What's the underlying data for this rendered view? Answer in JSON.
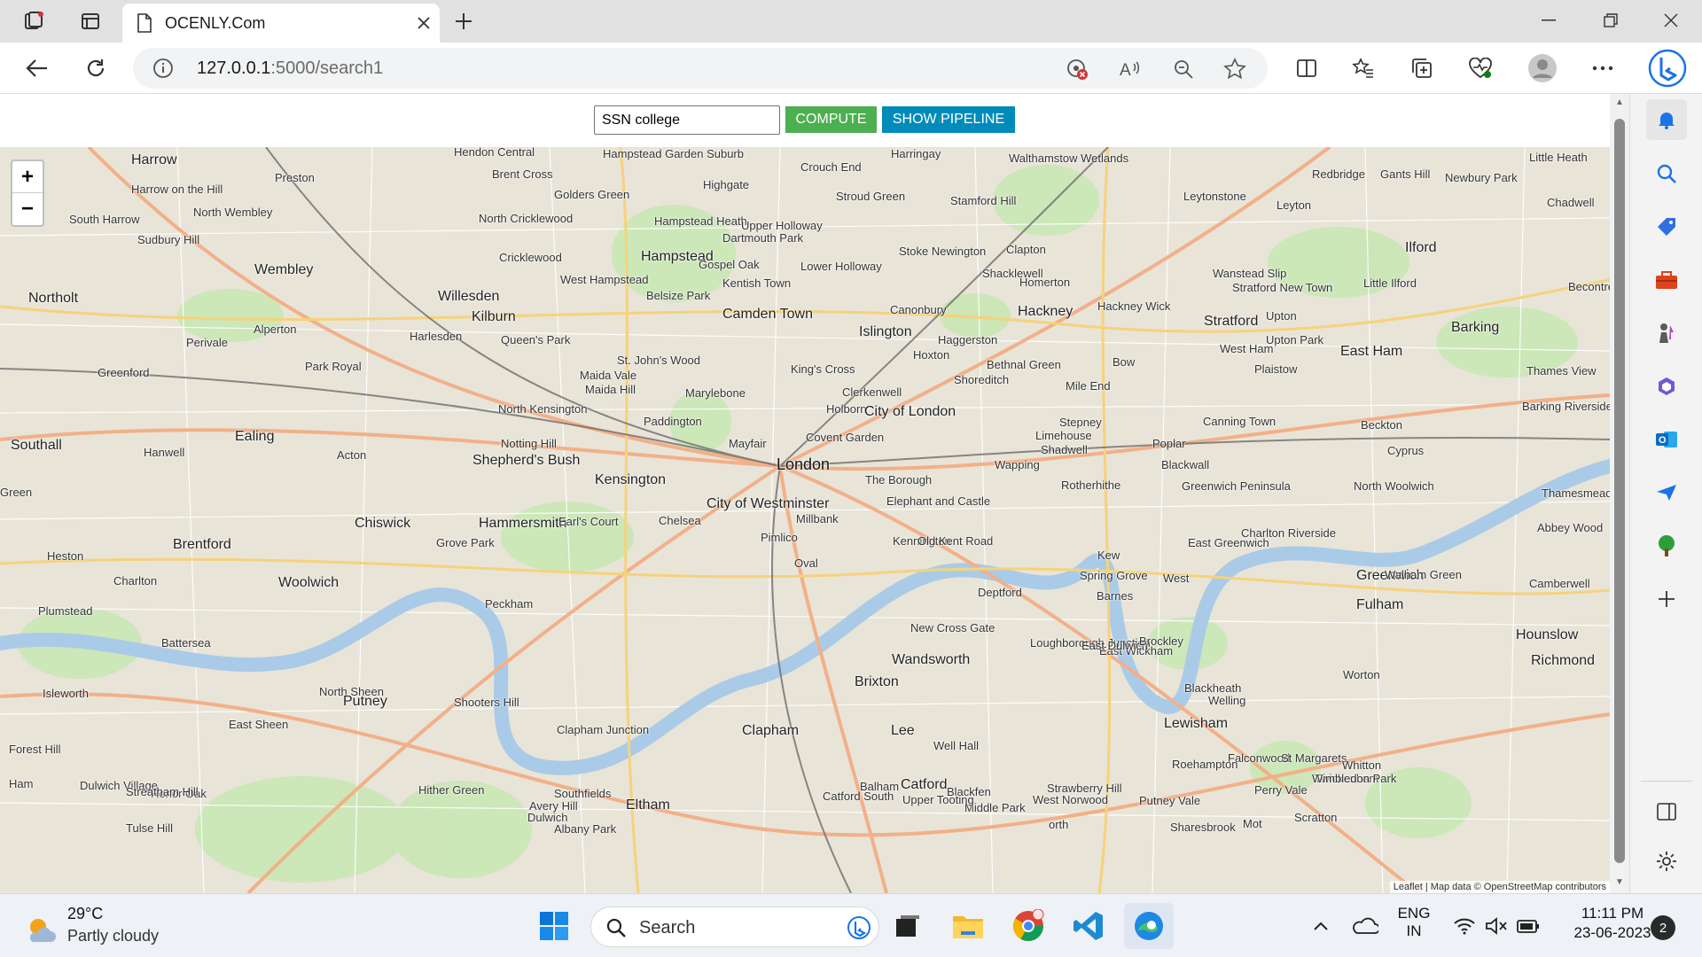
{
  "browser": {
    "tab_title": "OCENLY.Com",
    "url_host": "127.0.0.1",
    "url_rest": ":5000/search1"
  },
  "page": {
    "search_value": "SSN college",
    "compute_label": "COMPUTE",
    "pipeline_label": "SHOW PIPELINE",
    "zoom_in": "+",
    "zoom_out": "−",
    "attribution": "Leaflet | Map data © OpenStreetMap contributors"
  },
  "map_labels": [
    {
      "t": "Harrow",
      "c": "big"
    },
    {
      "t": "Hendon Central",
      "c": ""
    },
    {
      "t": "Hampstead Garden Suburb",
      "c": ""
    },
    {
      "t": "Crouch End",
      "c": ""
    },
    {
      "t": "Harringay",
      "c": ""
    },
    {
      "t": "Walthamstow Wetlands",
      "c": ""
    },
    {
      "t": "Leyton",
      "c": ""
    },
    {
      "t": "Redbridge",
      "c": ""
    },
    {
      "t": "Gants Hill",
      "c": ""
    },
    {
      "t": "Newbury Park",
      "c": ""
    },
    {
      "t": "Little Heath",
      "c": ""
    },
    {
      "t": "Preston",
      "c": ""
    },
    {
      "t": "Brent Cross",
      "c": ""
    },
    {
      "t": "Highgate",
      "c": ""
    },
    {
      "t": "Stroud Green",
      "c": ""
    },
    {
      "t": "Stamford Hill",
      "c": ""
    },
    {
      "t": "Leytonstone",
      "c": ""
    },
    {
      "t": "Chadwell",
      "c": ""
    },
    {
      "t": "Harrow on the Hill",
      "c": ""
    },
    {
      "t": "Golders Green",
      "c": ""
    },
    {
      "t": "North Wembley",
      "c": ""
    },
    {
      "t": "North Cricklewood",
      "c": ""
    },
    {
      "t": "Hampstead Heath",
      "c": ""
    },
    {
      "t": "Upper Holloway",
      "c": ""
    },
    {
      "t": "South Harrow",
      "c": ""
    },
    {
      "t": "Sudbury Hill",
      "c": ""
    },
    {
      "t": "Dartmouth Park",
      "c": ""
    },
    {
      "t": "Stoke Newington",
      "c": ""
    },
    {
      "t": "Clapton",
      "c": ""
    },
    {
      "t": "Ilford",
      "c": "big"
    },
    {
      "t": "Cricklewood",
      "c": ""
    },
    {
      "t": "Hampstead",
      "c": "big"
    },
    {
      "t": "Gospel Oak",
      "c": ""
    },
    {
      "t": "Lower Holloway",
      "c": ""
    },
    {
      "t": "Shacklewell",
      "c": ""
    },
    {
      "t": "Wanstead Slip",
      "c": ""
    },
    {
      "t": "Wembley",
      "c": "big"
    },
    {
      "t": "West Hampstead",
      "c": ""
    },
    {
      "t": "Kentish Town",
      "c": ""
    },
    {
      "t": "Homerton",
      "c": ""
    },
    {
      "t": "Stratford New Town",
      "c": ""
    },
    {
      "t": "Little Ilford",
      "c": ""
    },
    {
      "t": "Northolt",
      "c": "big"
    },
    {
      "t": "Willesden",
      "c": "big"
    },
    {
      "t": "Belsize Park",
      "c": ""
    },
    {
      "t": "Canonbury",
      "c": ""
    },
    {
      "t": "Hackney",
      "c": "big"
    },
    {
      "t": "Hackney Wick",
      "c": ""
    },
    {
      "t": "Becontree",
      "c": ""
    },
    {
      "t": "Kilburn",
      "c": "big"
    },
    {
      "t": "Camden Town",
      "c": "big"
    },
    {
      "t": "Stratford",
      "c": "big"
    },
    {
      "t": "Upton",
      "c": ""
    },
    {
      "t": "Barking",
      "c": "big"
    },
    {
      "t": "Alperton",
      "c": ""
    },
    {
      "t": "Harlesden",
      "c": ""
    },
    {
      "t": "Queen's Park",
      "c": ""
    },
    {
      "t": "Islington",
      "c": "big"
    },
    {
      "t": "Haggerston",
      "c": ""
    },
    {
      "t": "Upton Park",
      "c": ""
    },
    {
      "t": "Perivale",
      "c": ""
    },
    {
      "t": "Park Royal",
      "c": ""
    },
    {
      "t": "St. John's Wood",
      "c": ""
    },
    {
      "t": "Hoxton",
      "c": ""
    },
    {
      "t": "West Ham",
      "c": ""
    },
    {
      "t": "East Ham",
      "c": "big"
    },
    {
      "t": "Greenford",
      "c": ""
    },
    {
      "t": "Maida Vale",
      "c": ""
    },
    {
      "t": "King's Cross",
      "c": ""
    },
    {
      "t": "Bethnal Green",
      "c": ""
    },
    {
      "t": "Bow",
      "c": ""
    },
    {
      "t": "Plaistow",
      "c": ""
    },
    {
      "t": "Thames View",
      "c": ""
    },
    {
      "t": "Maida Hill",
      "c": ""
    },
    {
      "t": "Marylebone",
      "c": ""
    },
    {
      "t": "Clerkenwell",
      "c": ""
    },
    {
      "t": "Shoreditch",
      "c": ""
    },
    {
      "t": "Mile End",
      "c": ""
    },
    {
      "t": "Barking Riverside",
      "c": ""
    },
    {
      "t": "North Kensington",
      "c": ""
    },
    {
      "t": "Paddington",
      "c": ""
    },
    {
      "t": "Holborn",
      "c": ""
    },
    {
      "t": "City of London",
      "c": "big"
    },
    {
      "t": "Stepney",
      "c": ""
    },
    {
      "t": "Canning Town",
      "c": ""
    },
    {
      "t": "Beckton",
      "c": ""
    },
    {
      "t": "Southall",
      "c": "big"
    },
    {
      "t": "Ealing",
      "c": "big"
    },
    {
      "t": "Notting Hill",
      "c": ""
    },
    {
      "t": "Mayfair",
      "c": ""
    },
    {
      "t": "Covent Garden",
      "c": ""
    },
    {
      "t": "Limehouse",
      "c": ""
    },
    {
      "t": "Poplar",
      "c": ""
    },
    {
      "t": "Hanwell",
      "c": ""
    },
    {
      "t": "Acton",
      "c": ""
    },
    {
      "t": "Shepherd's Bush",
      "c": "big"
    },
    {
      "t": "London",
      "c": "xl"
    },
    {
      "t": "Shadwell",
      "c": ""
    },
    {
      "t": "Cyprus",
      "c": ""
    },
    {
      "t": "Wapping",
      "c": ""
    },
    {
      "t": "Blackwall",
      "c": ""
    },
    {
      "t": "Kensington",
      "c": "big"
    },
    {
      "t": "The Borough",
      "c": ""
    },
    {
      "t": "Rotherhithe",
      "c": ""
    },
    {
      "t": "Greenwich Peninsula",
      "c": ""
    },
    {
      "t": "North Woolwich",
      "c": ""
    },
    {
      "t": "Thamesmead",
      "c": ""
    },
    {
      "t": "Green",
      "c": ""
    },
    {
      "t": "Chiswick",
      "c": "big"
    },
    {
      "t": "Hammersmith",
      "c": "big"
    },
    {
      "t": "Earl's Court",
      "c": ""
    },
    {
      "t": "City of Westminster",
      "c": "big"
    },
    {
      "t": "Elephant and Castle",
      "c": ""
    },
    {
      "t": "Charlton Riverside",
      "c": ""
    },
    {
      "t": "Millbank",
      "c": ""
    },
    {
      "t": "Abbey Wood",
      "c": ""
    },
    {
      "t": "Brentford",
      "c": "big"
    },
    {
      "t": "Grove Park",
      "c": ""
    },
    {
      "t": "Chelsea",
      "c": ""
    },
    {
      "t": "Pimlico",
      "c": ""
    },
    {
      "t": "Kennington",
      "c": ""
    },
    {
      "t": "Old Kent Road",
      "c": ""
    },
    {
      "t": "East Greenwich",
      "c": ""
    },
    {
      "t": "Heston",
      "c": ""
    },
    {
      "t": "Oval",
      "c": ""
    },
    {
      "t": "Greenwich",
      "c": "big"
    },
    {
      "t": "Charlton",
      "c": ""
    },
    {
      "t": "Woolwich",
      "c": "big"
    },
    {
      "t": "Spring Grove",
      "c": ""
    },
    {
      "t": "Kew",
      "c": ""
    },
    {
      "t": "Walham Green",
      "c": ""
    },
    {
      "t": "Plumstead",
      "c": ""
    },
    {
      "t": "West",
      "c": ""
    },
    {
      "t": "Fulham",
      "c": "big"
    },
    {
      "t": "Camberwell",
      "c": ""
    },
    {
      "t": "Peckham",
      "c": ""
    },
    {
      "t": "New Cross Gate",
      "c": ""
    },
    {
      "t": "Deptford",
      "c": ""
    },
    {
      "t": "Barnes",
      "c": ""
    },
    {
      "t": "Battersea",
      "c": ""
    },
    {
      "t": "Loughborough Junction",
      "c": ""
    },
    {
      "t": "East Wickham",
      "c": ""
    },
    {
      "t": "Hounslow",
      "c": "big"
    },
    {
      "t": "Isleworth",
      "c": ""
    },
    {
      "t": "North Sheen",
      "c": ""
    },
    {
      "t": "Shooters Hill",
      "c": ""
    },
    {
      "t": "Worton",
      "c": ""
    },
    {
      "t": "Blackheath",
      "c": ""
    },
    {
      "t": "Welling",
      "c": ""
    },
    {
      "t": "Richmond",
      "c": "big"
    },
    {
      "t": "East Sheen",
      "c": ""
    },
    {
      "t": "Putney",
      "c": "big"
    },
    {
      "t": "Clapham Junction",
      "c": ""
    },
    {
      "t": "Clapham",
      "c": "big"
    },
    {
      "t": "Lewisham",
      "c": "big"
    },
    {
      "t": "Wandsworth",
      "c": "big"
    },
    {
      "t": "Brixton",
      "c": "big"
    },
    {
      "t": "East Dulwich",
      "c": ""
    },
    {
      "t": "Brockley",
      "c": ""
    },
    {
      "t": "Lee",
      "c": "big"
    },
    {
      "t": "Well Hall",
      "c": ""
    },
    {
      "t": "Falconwood",
      "c": ""
    },
    {
      "t": "St Margarets",
      "c": ""
    },
    {
      "t": "Whitton",
      "c": ""
    },
    {
      "t": "Dulwich Village",
      "c": ""
    },
    {
      "t": "Honor Oak",
      "c": ""
    },
    {
      "t": "Hither Green",
      "c": ""
    },
    {
      "t": "Eltham",
      "c": "big"
    },
    {
      "t": "Avery Hill",
      "c": ""
    },
    {
      "t": "Blackfen",
      "c": ""
    },
    {
      "t": "Roehampton",
      "c": ""
    },
    {
      "t": "Twickenham",
      "c": ""
    },
    {
      "t": "Southfields",
      "c": ""
    },
    {
      "t": "Balham",
      "c": ""
    },
    {
      "t": "Catford",
      "c": "big"
    },
    {
      "t": "Middle Park",
      "c": ""
    },
    {
      "t": "Streatham Hill",
      "c": ""
    },
    {
      "t": "Tulse Hill",
      "c": ""
    },
    {
      "t": "Dulwich",
      "c": ""
    },
    {
      "t": "Catford South",
      "c": ""
    },
    {
      "t": "Strawberry Hill",
      "c": ""
    },
    {
      "t": "Putney Vale",
      "c": ""
    },
    {
      "t": "Wimbledon Park",
      "c": ""
    },
    {
      "t": "Forest Hill",
      "c": ""
    },
    {
      "t": "Ham",
      "c": ""
    },
    {
      "t": "Upper Tooting",
      "c": ""
    },
    {
      "t": "West Norwood",
      "c": ""
    },
    {
      "t": "Perry Vale",
      "c": ""
    },
    {
      "t": "Albany Park",
      "c": ""
    },
    {
      "t": "Sharesbrook",
      "c": ""
    },
    {
      "t": "Scratton",
      "c": ""
    },
    {
      "t": "orth",
      "c": ""
    },
    {
      "t": "Mot",
      "c": ""
    }
  ],
  "taskbar": {
    "temp": "29°C",
    "weather": "Partly cloudy",
    "search_label": "Search",
    "lang1": "ENG",
    "lang2": "IN",
    "time": "11:11 PM",
    "date": "23-06-2023",
    "notif_count": "2"
  }
}
